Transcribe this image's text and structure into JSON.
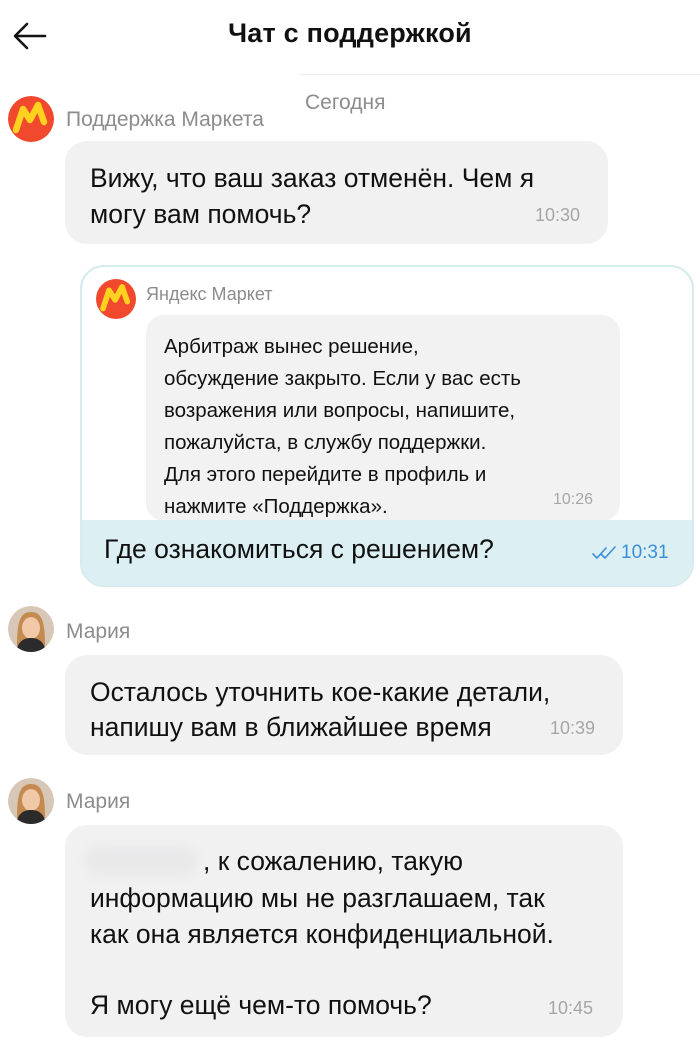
{
  "header": {
    "title": "Чат с поддержкой"
  },
  "date_separator": "Сегодня",
  "messages": [
    {
      "sender": "Поддержка Маркета",
      "text_lines": [
        "Вижу, что ваш заказ отменён. Чем я",
        "могу вам помочь?"
      ],
      "time": "10:30"
    },
    {
      "quoted": {
        "sender": "Яндекс Маркет",
        "text_lines": [
          "Арбитраж вынес решение,",
          "обсуждение закрыто. Если у вас есть",
          "возражения или вопросы, напишите,",
          "пожалуйста, в службу поддержки.",
          "Для этого перейдите в профиль и",
          "нажмите «Поддержка»."
        ],
        "time": "10:26"
      },
      "text": "Где ознакомиться с решением?",
      "time": "10:31",
      "status_icon": "double-check-icon"
    },
    {
      "sender": "Мария",
      "text_lines": [
        "Осталось уточнить кое-какие детали,",
        "напишу вам в ближайшее время"
      ],
      "time": "10:39"
    },
    {
      "sender": "Мария",
      "text_lines": [
        ", к сожалению, такую",
        "информацию мы не разглашаем, так",
        "как она является конфиденциальной.",
        "",
        "Я могу ещё чем-то помочь?"
      ],
      "time": "10:45"
    }
  ],
  "colors": {
    "market_logo_red": "#f0492e",
    "market_logo_yellow": "#ffd21f",
    "bubble_gray": "#f1f1f2",
    "reply_blue": "#dcf0f4",
    "check_blue": "#3b8fd9"
  }
}
